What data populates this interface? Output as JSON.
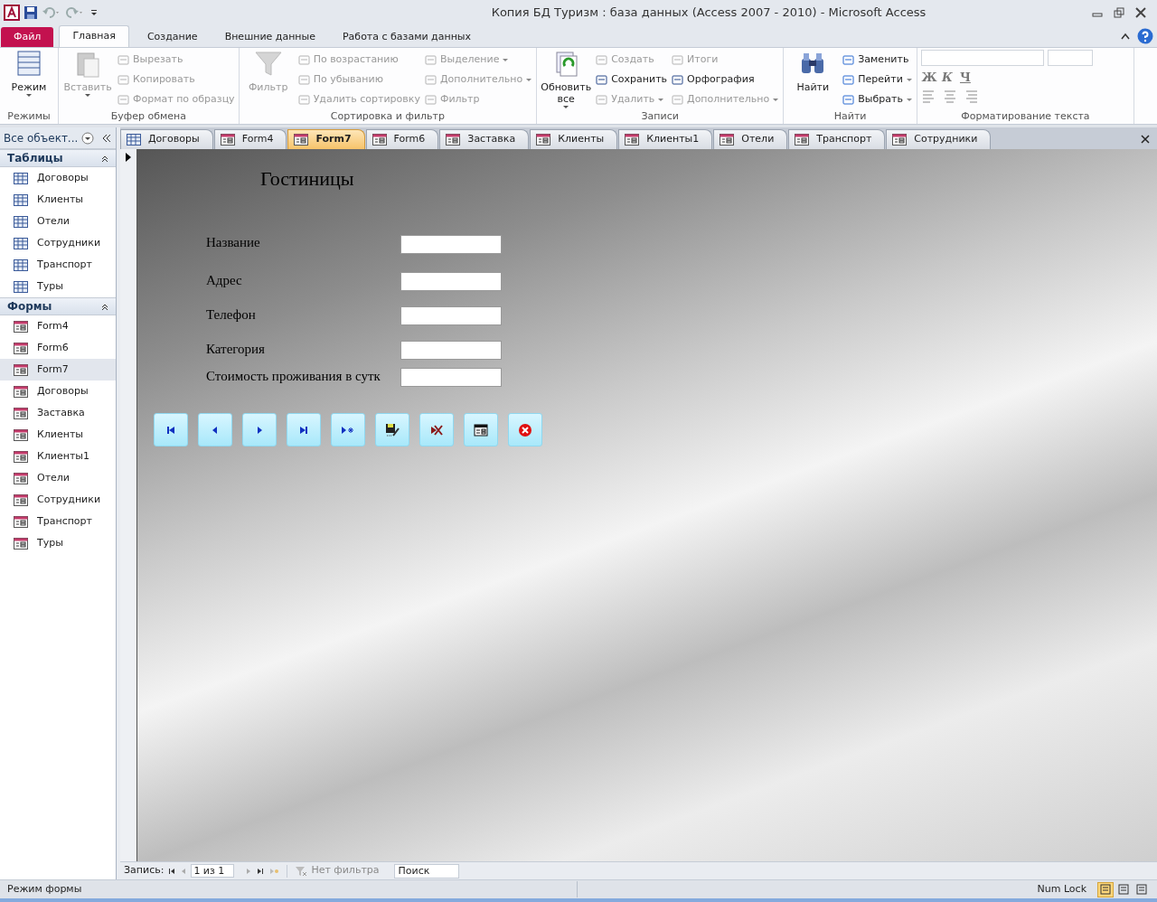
{
  "window": {
    "title": "Копия БД Туризм : база данных (Access 2007 - 2010)  -  Microsoft Access"
  },
  "ribbon_tabs": [
    {
      "label": "Файл",
      "kind": "file",
      "selected": false
    },
    {
      "label": "Главная",
      "kind": "tab",
      "selected": true
    },
    {
      "label": "Создание",
      "kind": "tab",
      "selected": false
    },
    {
      "label": "Внешние данные",
      "kind": "tab",
      "selected": false
    },
    {
      "label": "Работа с базами данных",
      "kind": "tab",
      "selected": false
    }
  ],
  "ribbon_groups": [
    {
      "label": "Режимы",
      "items": [
        {
          "label": "Режим",
          "kind": "large",
          "disabled": false,
          "dropdown": true
        }
      ]
    },
    {
      "label": "Буфер обмена",
      "items": [
        {
          "label": "Вставить",
          "kind": "large",
          "disabled": true,
          "dropdown": true
        },
        {
          "label": "Вырезать",
          "kind": "small",
          "disabled": true,
          "dropdown": false
        },
        {
          "label": "Копировать",
          "kind": "small",
          "disabled": true,
          "dropdown": false
        },
        {
          "label": "Формат по образцу",
          "kind": "small",
          "disabled": true,
          "dropdown": false
        }
      ]
    },
    {
      "label": "Сортировка и фильтр",
      "items": [
        {
          "label": "Фильтр",
          "kind": "large",
          "disabled": true,
          "dropdown": false
        },
        {
          "label": "По возрастанию",
          "kind": "small",
          "disabled": true,
          "dropdown": false
        },
        {
          "label": "По убыванию",
          "kind": "small",
          "disabled": true,
          "dropdown": false
        },
        {
          "label": "Удалить сортировку",
          "kind": "small",
          "disabled": true,
          "dropdown": false
        },
        {
          "label": "Выделение",
          "kind": "small",
          "disabled": true,
          "dropdown": true
        },
        {
          "label": "Дополнительно",
          "kind": "small",
          "disabled": true,
          "dropdown": true
        },
        {
          "label": "Фильтр",
          "kind": "small",
          "disabled": true,
          "dropdown": false
        }
      ]
    },
    {
      "label": "Записи",
      "items": [
        {
          "label": "Обновить все",
          "kind": "large",
          "disabled": false,
          "dropdown": true
        },
        {
          "label": "Создать",
          "kind": "small",
          "disabled": true,
          "dropdown": false
        },
        {
          "label": "Сохранить",
          "kind": "small",
          "disabled": false,
          "dropdown": false
        },
        {
          "label": "Удалить",
          "kind": "small",
          "disabled": true,
          "dropdown": true
        },
        {
          "label": "Итоги",
          "kind": "small",
          "disabled": true,
          "dropdown": false
        },
        {
          "label": "Орфография",
          "kind": "small",
          "disabled": false,
          "dropdown": false
        },
        {
          "label": "Дополнительно",
          "kind": "small",
          "disabled": true,
          "dropdown": true
        }
      ]
    },
    {
      "label": "Найти",
      "items": [
        {
          "label": "Найти",
          "kind": "large",
          "disabled": false,
          "dropdown": false
        },
        {
          "label": "Заменить",
          "kind": "small",
          "disabled": false,
          "dropdown": false
        },
        {
          "label": "Перейти",
          "kind": "small",
          "disabled": false,
          "dropdown": true
        },
        {
          "label": "Выбрать",
          "kind": "small",
          "disabled": false,
          "dropdown": true
        }
      ]
    },
    {
      "label": "Форматирование текста",
      "items": [
        {
          "label": "Ж",
          "kind": "format",
          "disabled": true
        },
        {
          "label": "К",
          "kind": "format",
          "disabled": true
        },
        {
          "label": "Ч",
          "kind": "format",
          "disabled": true
        }
      ]
    }
  ],
  "nav_pane": {
    "header": "Все объект...",
    "groups": [
      {
        "label": "Таблицы",
        "kind": "table",
        "items": [
          {
            "label": "Договоры",
            "selected": false
          },
          {
            "label": "Клиенты",
            "selected": false
          },
          {
            "label": "Отели",
            "selected": false
          },
          {
            "label": "Сотрудники",
            "selected": false
          },
          {
            "label": "Транспорт",
            "selected": false
          },
          {
            "label": "Туры",
            "selected": false
          }
        ]
      },
      {
        "label": "Формы",
        "kind": "form",
        "items": [
          {
            "label": "Form4",
            "selected": false
          },
          {
            "label": "Form6",
            "selected": false
          },
          {
            "label": "Form7",
            "selected": true
          },
          {
            "label": "Договоры",
            "selected": false
          },
          {
            "label": "Заставка",
            "selected": false
          },
          {
            "label": "Клиенты",
            "selected": false
          },
          {
            "label": "Клиенты1",
            "selected": false
          },
          {
            "label": "Отели",
            "selected": false
          },
          {
            "label": "Сотрудники",
            "selected": false
          },
          {
            "label": "Транспорт",
            "selected": false
          },
          {
            "label": "Туры",
            "selected": false
          }
        ]
      }
    ]
  },
  "doc_tabs": [
    {
      "label": "Договоры",
      "kind": "table",
      "selected": false
    },
    {
      "label": "Form4",
      "kind": "form",
      "selected": false
    },
    {
      "label": "Form7",
      "kind": "form",
      "selected": true
    },
    {
      "label": "Form6",
      "kind": "form",
      "selected": false
    },
    {
      "label": "Заставка",
      "kind": "form",
      "selected": false
    },
    {
      "label": "Клиенты",
      "kind": "form",
      "selected": false
    },
    {
      "label": "Клиенты1",
      "kind": "form",
      "selected": false
    },
    {
      "label": "Отели",
      "kind": "form",
      "selected": false
    },
    {
      "label": "Транспорт",
      "kind": "form",
      "selected": false
    },
    {
      "label": "Сотрудники",
      "kind": "form",
      "selected": false
    }
  ],
  "form": {
    "title": "Гостиницы",
    "fields": [
      {
        "label": "Название"
      },
      {
        "label": "Адрес"
      },
      {
        "label": "Телефон"
      },
      {
        "label": "Категория"
      },
      {
        "label": "Стоимость проживания в сутк"
      }
    ],
    "buttons": [
      {
        "kind": "first"
      },
      {
        "kind": "prev"
      },
      {
        "kind": "next"
      },
      {
        "kind": "last"
      },
      {
        "kind": "new"
      },
      {
        "kind": "save"
      },
      {
        "kind": "delete"
      },
      {
        "kind": "form"
      },
      {
        "kind": "close"
      }
    ]
  },
  "record_nav": {
    "label": "Запись:",
    "position": "1 из 1",
    "filter": "Нет фильтра",
    "search": "Поиск"
  },
  "status_bar": {
    "mode": "Режим формы",
    "num_lock": "Num Lock",
    "views": [
      {
        "selected": true
      },
      {
        "selected": false
      },
      {
        "selected": false
      }
    ]
  }
}
